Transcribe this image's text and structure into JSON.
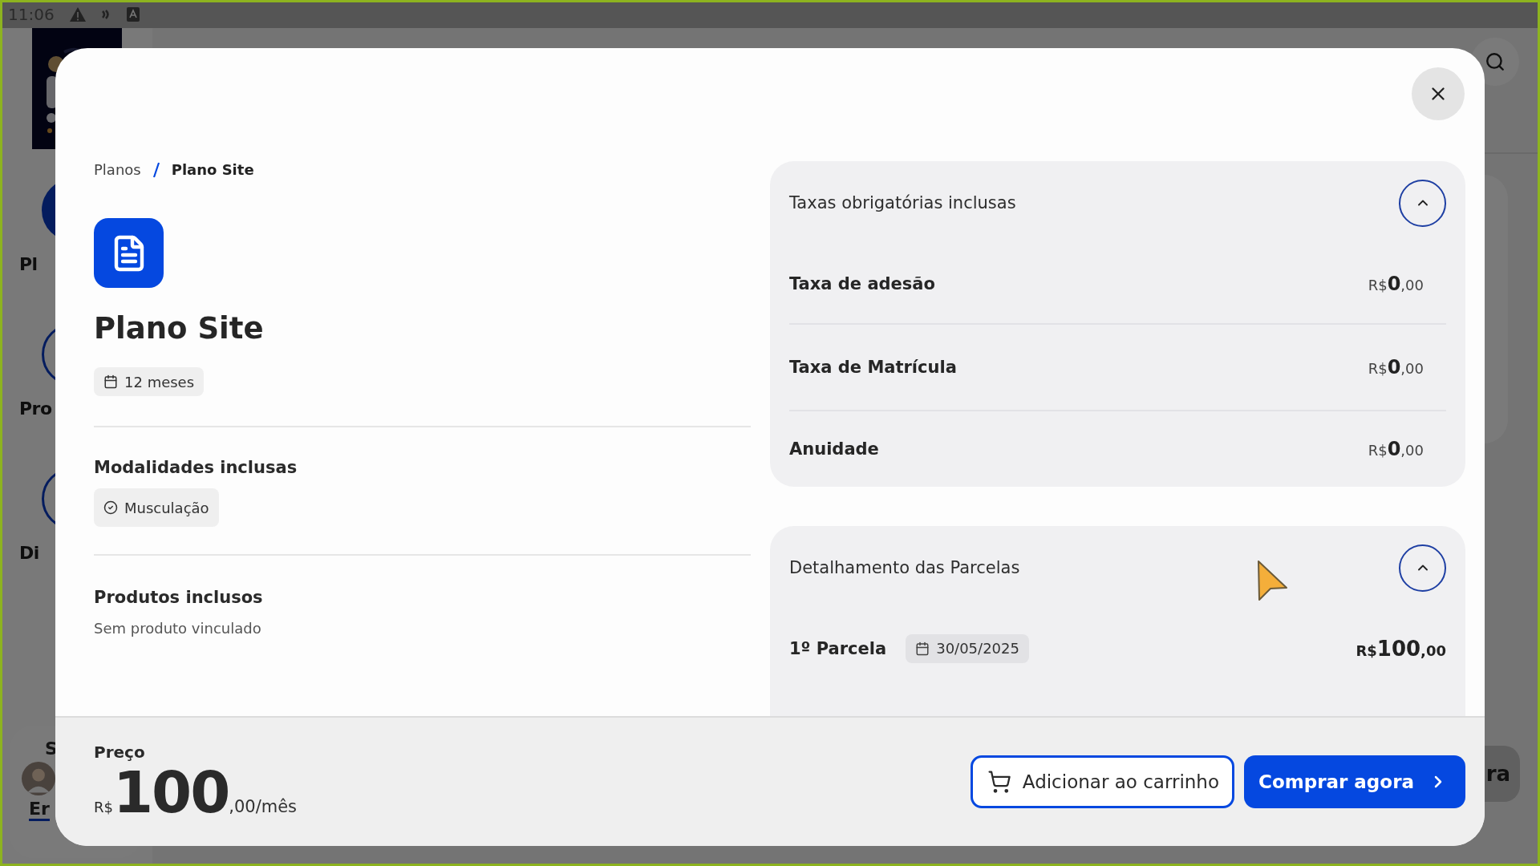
{
  "status_bar": {
    "time": "11:06"
  },
  "background": {
    "sidebar_items": [
      {
        "label": "Pl",
        "selected": true
      },
      {
        "label": "Pro",
        "selected": false
      },
      {
        "label": "Di",
        "selected": false
      }
    ],
    "user_card": {
      "title": "S",
      "link": "Er"
    },
    "action_button": "ra"
  },
  "modal": {
    "breadcrumb": [
      "Planos",
      "Plano Site"
    ],
    "plan_name": "Plano Site",
    "duration": "12 meses",
    "modalities_title": "Modalidades inclusas",
    "modalities": [
      "Musculação"
    ],
    "products_title": "Produtos inclusos",
    "products_empty": "Sem produto vinculado",
    "fees": {
      "title": "Taxas obrigatórias inclusas",
      "expanded": true,
      "rows": [
        {
          "label": "Taxa de adesão",
          "currency": "R$",
          "integer": "0",
          "cents": ",00"
        },
        {
          "label": "Taxa de Matrícula",
          "currency": "R$",
          "integer": "0",
          "cents": ",00"
        },
        {
          "label": "Anuidade",
          "currency": "R$",
          "integer": "0",
          "cents": ",00"
        }
      ]
    },
    "installments": {
      "title": "Detalhamento das Parcelas",
      "expanded": true,
      "rows": [
        {
          "label": "1º Parcela",
          "date": "30/05/2025",
          "currency": "R$",
          "integer": "100",
          "cents": ",00"
        }
      ]
    },
    "price": {
      "label": "Preço",
      "currency": "R$",
      "integer": "100",
      "suffix": ",00/mês"
    },
    "buttons": [
      {
        "kind": "outline",
        "label": "Adicionar ao carrinho"
      },
      {
        "kind": "primary",
        "label": "Comprar agora"
      }
    ]
  }
}
